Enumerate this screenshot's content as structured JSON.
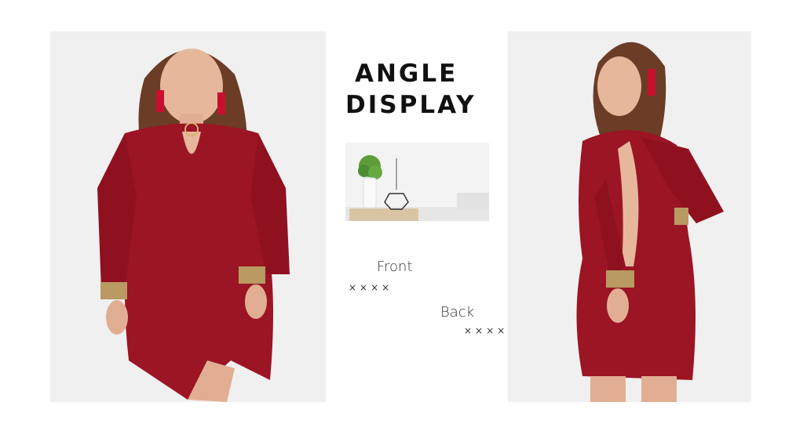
{
  "heading": {
    "line1": "ANGLE",
    "line2": "DISPLAY"
  },
  "views": [
    {
      "label": "Front",
      "marks": "××××"
    },
    {
      "label": "Back",
      "marks": "××××"
    }
  ],
  "colors": {
    "dress": "#9b1524",
    "background": "#f1f0f0",
    "text": "#111111"
  }
}
